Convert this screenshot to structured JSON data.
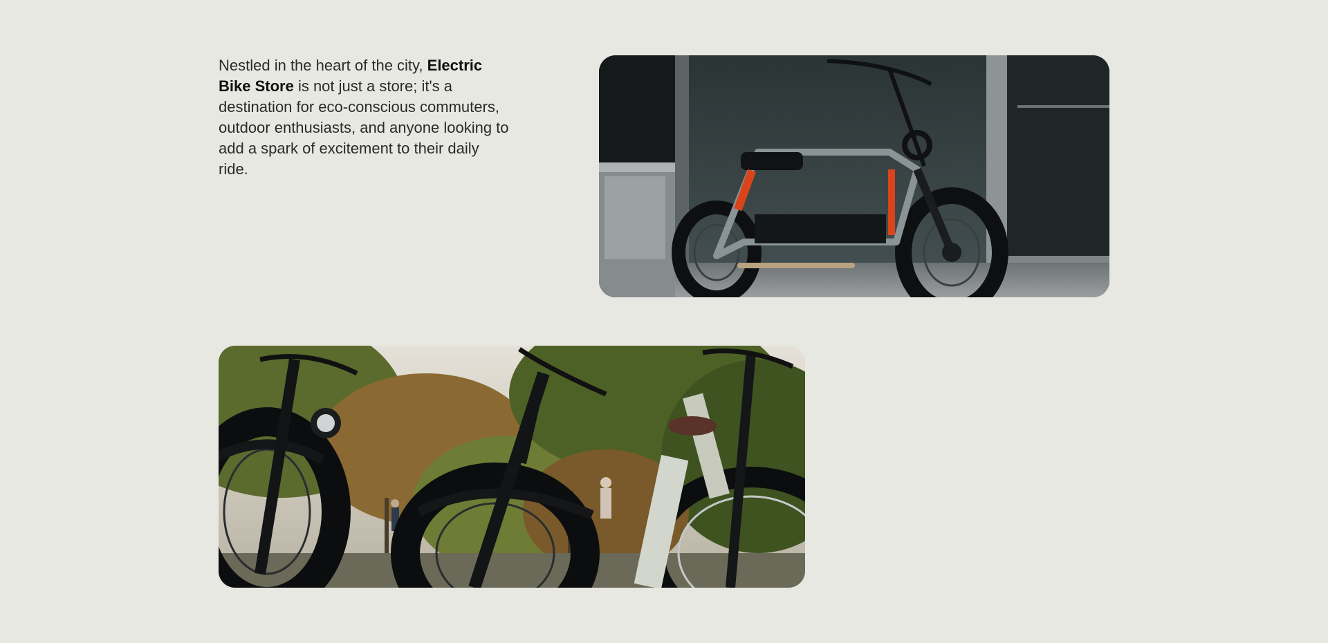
{
  "intro": {
    "text_before": "Nestled in the heart of the city, ",
    "store_name": "Electric Bike Store",
    "text_after": " is not just a store; it's a destination for eco-conscious commuters, outdoor enthusiasts, and anyone looking to add a spark of excitement to their daily ride."
  },
  "images": [
    {
      "subject": "electric-scooter-bike-photo"
    },
    {
      "subject": "fat-tire-ebikes-photo"
    }
  ]
}
